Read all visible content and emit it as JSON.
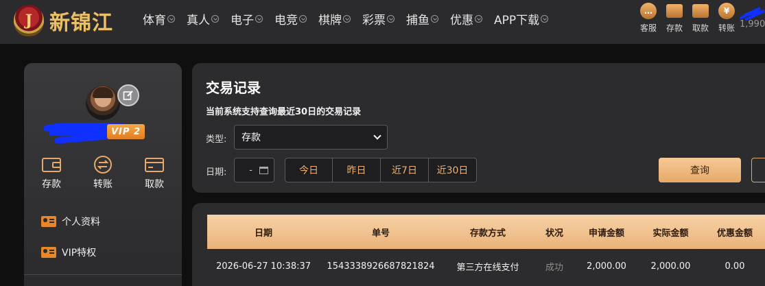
{
  "brand": {
    "badge_letter": "J",
    "name": "新锦江"
  },
  "nav": [
    "体育",
    "真人",
    "电子",
    "电竞",
    "棋牌",
    "彩票",
    "捕鱼",
    "优惠",
    "APP下载"
  ],
  "tools": [
    {
      "label": "客服",
      "icon": "chat-icon"
    },
    {
      "label": "存款",
      "icon": "wallet-icon"
    },
    {
      "label": "取款",
      "icon": "withdraw-icon"
    },
    {
      "label": "转账",
      "icon": "coin-icon"
    }
  ],
  "balance": "1,990",
  "profile": {
    "vip": "VIP 2"
  },
  "quick_actions": [
    "存款",
    "转账",
    "取款"
  ],
  "menu": [
    "个人资料",
    "VIP特权"
  ],
  "panel": {
    "title": "交易记录",
    "subtitle": "当前系统支持查询最近30日的交易记录",
    "type_label": "类型:",
    "type_value": "存款",
    "date_label": "日期:",
    "date_value": "-",
    "ranges": [
      "今日",
      "昨日",
      "近7日",
      "近30日"
    ],
    "query": "查询"
  },
  "table": {
    "headers": [
      "日期",
      "单号",
      "存款方式",
      "状况",
      "申请金额",
      "实际金额",
      "优惠金额"
    ],
    "rows": [
      [
        "2026-06-27 10:38:37",
        "1543338926687821824",
        "第三方在线支付",
        "成功",
        "2,000.00",
        "2,000.00",
        "0.00"
      ]
    ]
  },
  "colors": {
    "accent": "#e8a96a",
    "vip": "#e88a2a",
    "bg": "#0f0f10",
    "panel": "#2c2c2e"
  }
}
